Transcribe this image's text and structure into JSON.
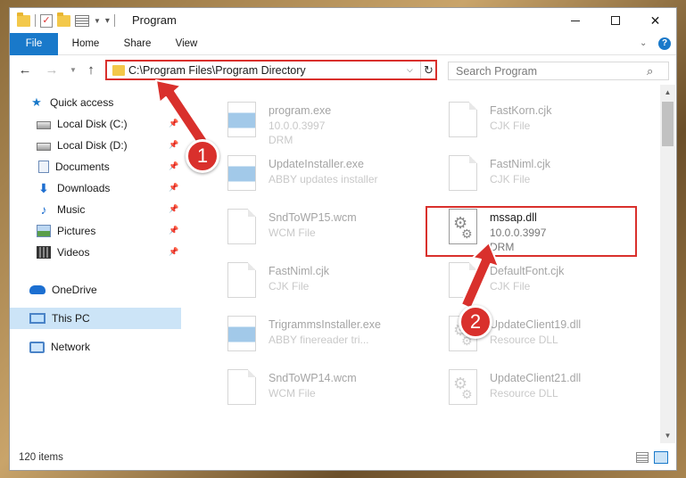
{
  "window": {
    "title": "Program",
    "controls": {
      "minimize": "",
      "maximize": "",
      "close": "✕"
    }
  },
  "ribbon": {
    "tabs": [
      "File",
      "Home",
      "Share",
      "View"
    ],
    "help": "?"
  },
  "nav": {
    "address": "C:\\Program Files\\Program Directory",
    "search_placeholder": "Search Program"
  },
  "sidebar": {
    "items": [
      {
        "label": "Quick access",
        "icon": "star-icon",
        "pinned": false
      },
      {
        "label": "Local Disk (C:)",
        "icon": "disk-icon",
        "pinned": true
      },
      {
        "label": "Local Disk (D:)",
        "icon": "disk-icon",
        "pinned": true
      },
      {
        "label": "Documents",
        "icon": "documents-icon",
        "pinned": true
      },
      {
        "label": "Downloads",
        "icon": "download-icon",
        "pinned": true
      },
      {
        "label": "Music",
        "icon": "music-icon",
        "pinned": true
      },
      {
        "label": "Pictures",
        "icon": "pictures-icon",
        "pinned": true
      },
      {
        "label": "Videos",
        "icon": "videos-icon",
        "pinned": true
      },
      {
        "label": "OneDrive",
        "icon": "cloud-icon",
        "pinned": false
      },
      {
        "label": "This PC",
        "icon": "computer-icon",
        "pinned": false,
        "selected": true
      },
      {
        "label": "Network",
        "icon": "network-icon",
        "pinned": false
      }
    ]
  },
  "files": [
    {
      "name": "program.exe",
      "meta1": "10.0.0.3997",
      "meta2": "DRM",
      "icon": "exe-icon"
    },
    {
      "name": "FastKorn.cjk",
      "meta1": "CJK File",
      "meta2": "",
      "icon": "document-icon"
    },
    {
      "name": "UpdateInstaller.exe",
      "meta1": "ABBY updates installer",
      "meta2": "",
      "icon": "exe-icon"
    },
    {
      "name": "FastNiml.cjk",
      "meta1": "CJK File",
      "meta2": "",
      "icon": "document-icon"
    },
    {
      "name": "SndToWP15.wcm",
      "meta1": "WCM File",
      "meta2": "",
      "icon": "document-icon"
    },
    {
      "name": "mssap.dll",
      "meta1": "10.0.0.3997",
      "meta2": "DRM",
      "icon": "dll-icon",
      "highlighted": true
    },
    {
      "name": "FastNiml.cjk",
      "meta1": "CJK File",
      "meta2": "",
      "icon": "document-icon"
    },
    {
      "name": "DefaultFont.cjk",
      "meta1": "CJK File",
      "meta2": "",
      "icon": "document-icon"
    },
    {
      "name": "TrigrammsInstaller.exe",
      "meta1": "ABBY finereader tri...",
      "meta2": "",
      "icon": "exe-icon"
    },
    {
      "name": "UpdateClient19.dll",
      "meta1": "Resource DLL",
      "meta2": "",
      "icon": "dll-icon"
    },
    {
      "name": "SndToWP14.wcm",
      "meta1": "WCM File",
      "meta2": "",
      "icon": "document-icon"
    },
    {
      "name": "UpdateClient21.dll",
      "meta1": "Resource DLL",
      "meta2": "",
      "icon": "dll-icon"
    }
  ],
  "status": {
    "items": "120 items"
  },
  "annotations": {
    "step1": "1",
    "step2": "2"
  },
  "colors": {
    "accent": "#1979ca",
    "annotation": "#d9302c",
    "selection": "#cce4f7"
  }
}
